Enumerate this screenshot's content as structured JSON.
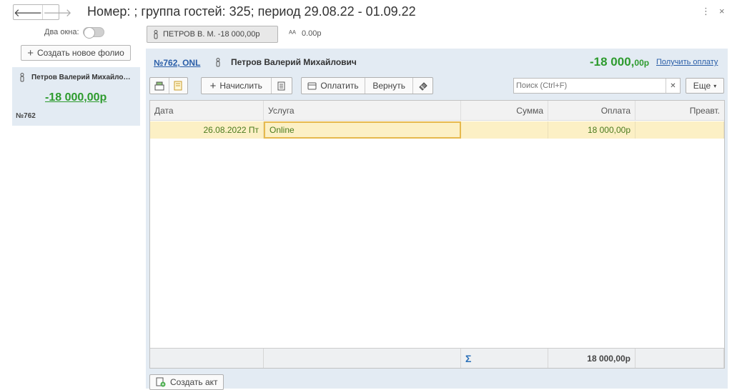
{
  "window": {
    "title": "Номер: ; группа гостей: 325; период 29.08.22 - 01.09.22",
    "back_icon": "arrow-left-icon",
    "forward_icon": "arrow-right-icon",
    "menu_glyph": "⋮",
    "close_glyph": "×"
  },
  "sidebar": {
    "two_windows_label": "Два окна:",
    "two_windows_on": false,
    "create_folio_label": "Создать новое фолио",
    "folio": {
      "guest": "Петров Валерий Михайло…",
      "amount": "-18 000,00р",
      "number": "№762"
    }
  },
  "guest_tab": {
    "label": "ПЕТРОВ В. М. -18 000,00р"
  },
  "balance_top": "0.00р",
  "panel": {
    "folio_link": "№762, ONL",
    "guest_name": "Петров Валерий Михайлович",
    "amount_main": "-18 000,",
    "amount_cents": "00р",
    "get_payment_label": "Получить оплату",
    "toolbar": {
      "charge_label": "Начислить",
      "pay_label": "Оплатить",
      "refund_label": "Вернуть",
      "search_placeholder": "Поиск (Ctrl+F)",
      "more_label": "Еще"
    }
  },
  "table": {
    "columns": [
      "Дата",
      "Услуга",
      "Сумма",
      "Оплата",
      "Преавт."
    ],
    "rows": [
      {
        "date": "26.08.2022 Пт",
        "service": "Online",
        "sum": "",
        "payment": "18 000,00р",
        "preauth": ""
      }
    ],
    "footer": {
      "sigma": "Σ",
      "payment_total": "18 000,00р"
    }
  },
  "bottom": {
    "create_act_label": "Создать акт"
  },
  "colors": {
    "panel_bg": "#e3ebf3",
    "amount_green": "#2e9b2e",
    "link_blue": "#2a5ea8",
    "row_highlight": "#fcf0c5"
  }
}
